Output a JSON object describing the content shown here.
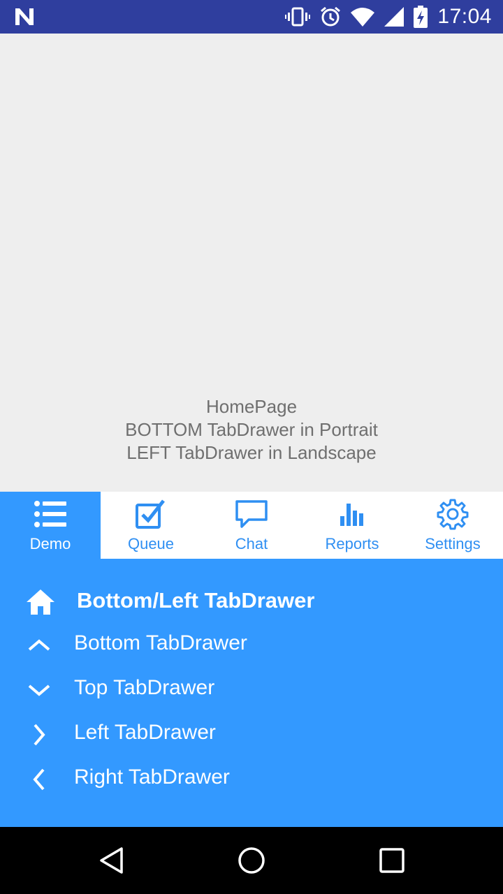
{
  "status_bar": {
    "time": "17:04",
    "icons": [
      "notification-n-icon",
      "vibrate-icon",
      "alarm-icon",
      "wifi-icon",
      "signal-icon",
      "battery-charging-icon"
    ]
  },
  "home": {
    "line1": "HomePage",
    "line2": "BOTTOM TabDrawer in Portrait",
    "line3": "LEFT TabDrawer in Landscape"
  },
  "tabs": [
    {
      "label": "Demo",
      "icon": "list-icon",
      "active": true
    },
    {
      "label": "Queue",
      "icon": "checkbox-icon",
      "active": false
    },
    {
      "label": "Chat",
      "icon": "chat-bubble-icon",
      "active": false
    },
    {
      "label": "Reports",
      "icon": "bar-chart-icon",
      "active": false
    },
    {
      "label": "Settings",
      "icon": "gear-icon",
      "active": false
    }
  ],
  "drawer": {
    "title": "Bottom/Left TabDrawer",
    "items": [
      {
        "label": "Bottom TabDrawer",
        "icon": "chevron-up-icon"
      },
      {
        "label": "Top TabDrawer",
        "icon": "chevron-down-icon"
      },
      {
        "label": "Left TabDrawer",
        "icon": "chevron-right-icon"
      },
      {
        "label": "Right TabDrawer",
        "icon": "chevron-left-icon"
      }
    ]
  },
  "colors": {
    "status_bar": "#2f3e9e",
    "accent": "#3399ff",
    "tab_text": "#2f8ff2",
    "background": "#eeeeee"
  }
}
